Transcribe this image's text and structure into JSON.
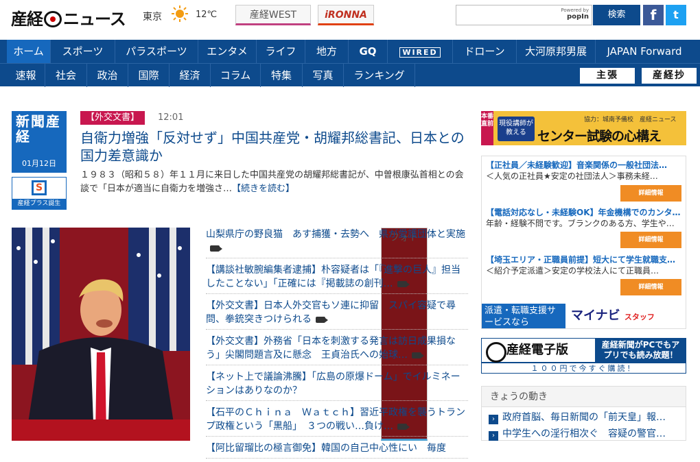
{
  "header": {
    "logo": "産経",
    "logo_suffix": "ニュース",
    "weather_city": "東京",
    "weather_icon": "sun-icon",
    "temperature": "12℃",
    "tabs": [
      "産経WEST",
      "iRONNA",
      "フォト"
    ],
    "search_powered_by": "Powered by",
    "search_brand": "popIn",
    "search_button": "検索",
    "facebook_icon": "f",
    "twitter_icon": "t"
  },
  "nav_primary": [
    "ホーム",
    "スポーツ",
    "パラスポーツ",
    "エンタメ",
    "ライフ",
    "地方",
    "GQ",
    "WIRED",
    "ドローン",
    "大河原邦男展",
    "JAPAN Forward"
  ],
  "nav_secondary": [
    "速報",
    "社会",
    "政治",
    "国際",
    "経済",
    "コラム",
    "特集",
    "写真",
    "ランキング"
  ],
  "nav_secondary_right": [
    "主張",
    "産経抄"
  ],
  "paper": {
    "title": "新聞産経",
    "date": "01月12日"
  },
  "sankei_plus": {
    "badge": "S",
    "label": "産経プラス誕生"
  },
  "top_story": {
    "tag": "【外交文書】",
    "time": "12:01",
    "headline": "自衛力増強「反対せず」中国共産党・胡耀邦総書記、日本との国力差意識か",
    "lead": "１９８３（昭和５８）年１１月に来日した中国共産党の胡耀邦総書記が、中曽根康弘首相との会談で「日本が適当に自衛力を増強さ…",
    "more": "【続きを読む】"
  },
  "news_list": [
    "山梨県庁の野良猫　あす捕獲・去勢へ　県が愛護団体と実施",
    "【講談社敏腕編集者逮捕】朴容疑者は「『進撃の巨人』担当したことない」「正確には『掲載誌の創刊…",
    "【外交文書】日本人外交官もソ連に抑留　スパイ容疑で尋問、拳銃突きつけられる",
    "【外交文書】外務省「日本を刺激する発言は訪日成果損なう」尖閣問題言及に懸念　王貞治氏への始球…",
    "【ネット上で議論沸騰】「広島の原爆ドーム」でイルミネーションはありなのか？",
    "【石平のＣｈｉｎａ　Ｗａｔｃｈ】習近平政権を襲うトランプ政権という「黒船」　３つの戦い…負け…",
    "【阿比留瑠比の極言御免】韓国の自己中心性にい　毎度"
  ],
  "ad_banner": {
    "side_label": "本番直前",
    "sponsor": "協力：城南予備校　産経ニュース",
    "badge": "現役講師が教える",
    "headline": "センター試験の心構え"
  },
  "job_ads": {
    "items": [
      {
        "title": "【正社員／未経験歓迎】音楽関係の一般社団法…",
        "desc": "＜人気の正社員★安定の社団法人＞事務未経…",
        "button": "詳細情報"
      },
      {
        "title": "【電話対応なし・未経験OK】年金機構でのカンタ…",
        "desc": "年齢・経験不問です。ブランクのある方、学生や…",
        "button": "詳細情報"
      },
      {
        "title": "【埼玉エリア・正職員前提】短大にて学生就職支…",
        "desc": "＜紹介予定派遣＞安定の学校法人にて正職員…",
        "button": "詳細情報"
      }
    ],
    "footer_left": "派遣・転職支援サービスなら",
    "footer_brand": "マイナビ",
    "footer_suffix": "スタッフ"
  },
  "e_paper": {
    "title": "産経電子版",
    "pitch": "産経新聞がPCでもアプリでも読み放題！",
    "price": "１００円で今すぐ購読！"
  },
  "kyou": {
    "heading": "きょうの動き",
    "items": [
      "政府首脳、毎日新聞の「前天皇」報…",
      "中学生への淫行相次ぐ　容疑の警官…"
    ]
  }
}
